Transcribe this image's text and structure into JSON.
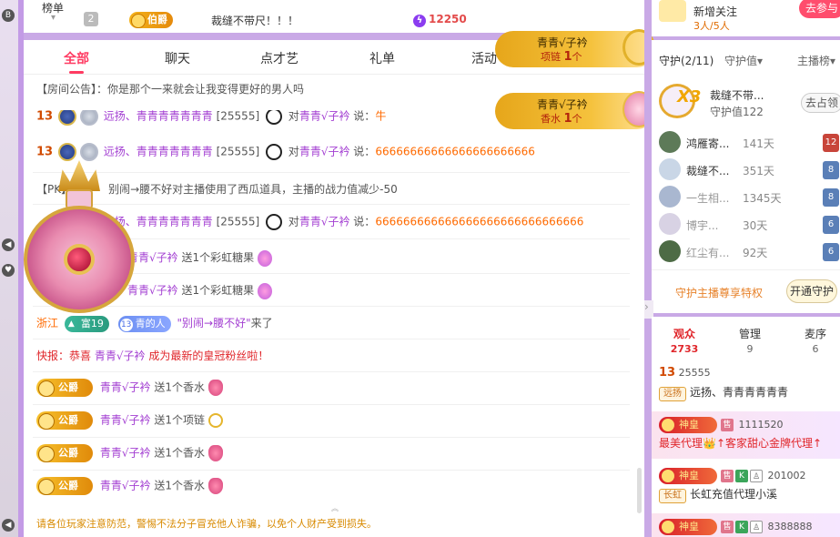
{
  "rank": {
    "title": "榜单",
    "row": {
      "num": "2",
      "badge": "伯爵",
      "text": "裁缝不带尺！！！",
      "score": "12250"
    }
  },
  "tabs": [
    "全部",
    "聊天",
    "点才艺",
    "礼单",
    "活动"
  ],
  "chat": {
    "announcement_label": "【房间公告】：",
    "announcement_text": "你是那个一来就会让我变得更好的男人吗",
    "line1": {
      "level": "13",
      "user": "远扬、青青青青青青青",
      "id": "[25555]",
      "to": "对",
      "target": "青青√子衿",
      "says": "说：",
      "content": "牛"
    },
    "line2": {
      "level": "13",
      "user": "远扬、青青青青青青青",
      "id": "[25555]",
      "to": "对",
      "target": "青青√子衿",
      "says": "说：",
      "content": "66666666666666666666666"
    },
    "pk": {
      "label": "【PK】",
      "text": "别闹→腰不好对主播使用了西瓜道具，主播的战力值减少-50"
    },
    "line3": {
      "level": "13",
      "user": "远扬、青青青青青青青",
      "id": "[25555]",
      "to": "对",
      "target": "青青√子衿",
      "says": "说：",
      "content": "666666666666666666666666666666"
    },
    "gift1": {
      "user": "青青√子衿",
      "text": "送1个彩虹糖果"
    },
    "gift2": {
      "user": "青青√子衿",
      "text": "送1个彩虹糖果"
    },
    "enter": {
      "region": "浙江",
      "rich": "富19",
      "blue_num": "13",
      "blue_tag": "青的人",
      "user": "\"别闹→腰不好\"",
      "action": "来了"
    },
    "flash": {
      "label": "快报：恭喜",
      "user": "青青√子衿",
      "text": "成为最新的皇冠粉丝啦！"
    },
    "duke_gifts": [
      {
        "badge": "公爵",
        "user": "青青√子衿",
        "text": "送1个香水"
      },
      {
        "badge": "公爵",
        "user": "青青√子衿",
        "text": "送1个项链"
      },
      {
        "badge": "公爵",
        "user": "青青√子衿",
        "text": "送1个香水"
      },
      {
        "badge": "公爵",
        "user": "青青√子衿",
        "text": "送1个香水"
      }
    ],
    "notice": "请各位玩家注意防范，警惕不法分子冒充他人诈骗，以免个人财产受到损失。"
  },
  "banners": [
    {
      "name": "青青√子衿",
      "item": "项链",
      "count": "1",
      "unit": "个"
    },
    {
      "name": "青青√子衿",
      "item": "香水",
      "count": "1",
      "unit": "个"
    }
  ],
  "right_top": {
    "title": "新增关注",
    "sub": "3人/5人",
    "btn": "去参与"
  },
  "guard": {
    "tab_guard": "守护(2/11)",
    "tab_value": "守护值▾",
    "tab_rank": "主播榜▾",
    "top": {
      "name": "裁缝不带...",
      "value": "守护值122",
      "grab": "去占领"
    },
    "rows": [
      {
        "name": "鸿雁寄...",
        "days": "141天",
        "badge": "12"
      },
      {
        "name": "裁缝不...",
        "days": "351天",
        "badge": "8"
      },
      {
        "name": "一生相...",
        "days": "1345天",
        "badge": "8"
      },
      {
        "name": "博宇...",
        "days": "30天",
        "badge": "6"
      },
      {
        "name": "红尘有...",
        "days": "92天",
        "badge": "6"
      }
    ],
    "privilege": "守护主播尊享特权",
    "open": "开通守护"
  },
  "audience": {
    "tabs": [
      {
        "label": "观众",
        "value": "2733"
      },
      {
        "label": "管理",
        "value": "9"
      },
      {
        "label": "麦序",
        "value": "6"
      }
    ],
    "items": [
      {
        "level": "13",
        "id": "25555",
        "chip": "远扬",
        "name": "远扬、青青青青青青"
      },
      {
        "badge": "神皇",
        "id": "1111520",
        "name": "最美代理👑↑客家甜心金牌代理↑"
      },
      {
        "badge": "神皇",
        "id": "201002",
        "chip": "长虹",
        "name": "长虹充值代理小溪"
      },
      {
        "badge": "神皇",
        "id": "8388888"
      }
    ]
  }
}
